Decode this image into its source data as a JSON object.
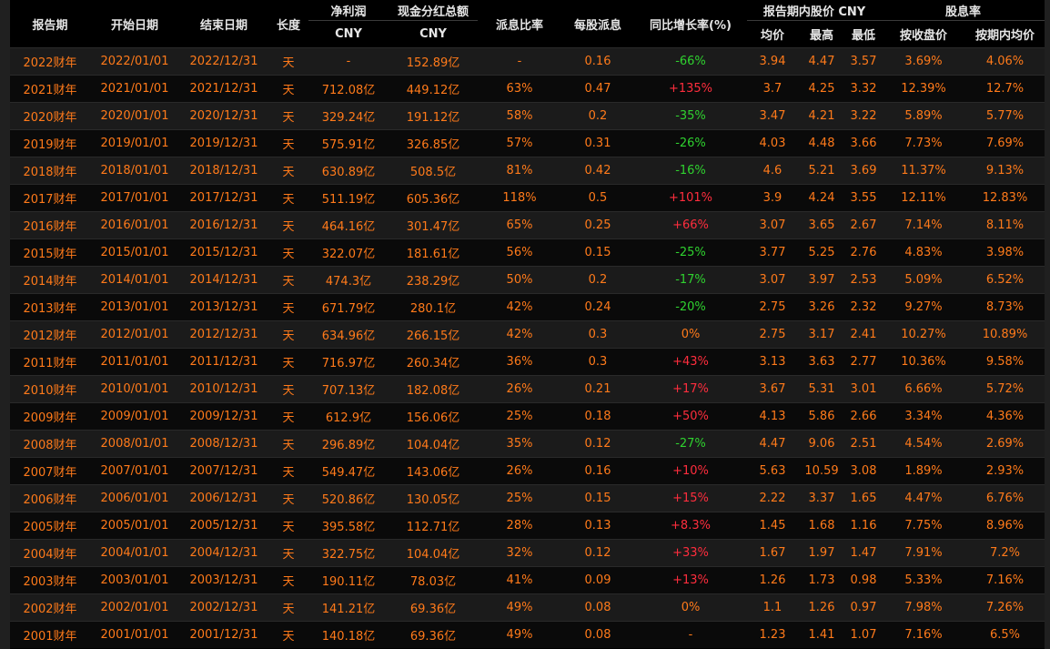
{
  "headers": {
    "period": "报告期",
    "start": "开始日期",
    "end": "结束日期",
    "length": "长度",
    "net_profit": "净利润",
    "net_profit_unit": "CNY",
    "cash_div": "现金分红总额",
    "cash_div_unit": "CNY",
    "payout_ratio": "派息比率",
    "dps": "每股派息",
    "yoy": "同比增长率(%)",
    "price_group": "报告期内股价 CNY",
    "avg": "均价",
    "high": "最高",
    "low": "最低",
    "yield_group": "股息率",
    "yield_close": "按收盘价",
    "yield_avg": "按期内均价"
  },
  "rows": [
    {
      "period": "2022财年",
      "start": "2022/01/01",
      "end": "2022/12/31",
      "len": "天",
      "np": "-",
      "div": "152.89亿",
      "payout": "-",
      "dps": "0.16",
      "yoy": "-66%",
      "yoy_type": "neg",
      "avg": "3.94",
      "high": "4.47",
      "low": "3.57",
      "y_close": "3.69%",
      "y_avg": "4.06%"
    },
    {
      "period": "2021财年",
      "start": "2021/01/01",
      "end": "2021/12/31",
      "len": "天",
      "np": "712.08亿",
      "div": "449.12亿",
      "payout": "63%",
      "dps": "0.47",
      "yoy": "+135%",
      "yoy_type": "pos",
      "avg": "3.7",
      "high": "4.25",
      "low": "3.32",
      "y_close": "12.39%",
      "y_avg": "12.7%"
    },
    {
      "period": "2020财年",
      "start": "2020/01/01",
      "end": "2020/12/31",
      "len": "天",
      "np": "329.24亿",
      "div": "191.12亿",
      "payout": "58%",
      "dps": "0.2",
      "yoy": "-35%",
      "yoy_type": "neg",
      "avg": "3.47",
      "high": "4.21",
      "low": "3.22",
      "y_close": "5.89%",
      "y_avg": "5.77%"
    },
    {
      "period": "2019财年",
      "start": "2019/01/01",
      "end": "2019/12/31",
      "len": "天",
      "np": "575.91亿",
      "div": "326.85亿",
      "payout": "57%",
      "dps": "0.31",
      "yoy": "-26%",
      "yoy_type": "neg",
      "avg": "4.03",
      "high": "4.48",
      "low": "3.66",
      "y_close": "7.73%",
      "y_avg": "7.69%"
    },
    {
      "period": "2018财年",
      "start": "2018/01/01",
      "end": "2018/12/31",
      "len": "天",
      "np": "630.89亿",
      "div": "508.5亿",
      "payout": "81%",
      "dps": "0.42",
      "yoy": "-16%",
      "yoy_type": "neg",
      "avg": "4.6",
      "high": "5.21",
      "low": "3.69",
      "y_close": "11.37%",
      "y_avg": "9.13%"
    },
    {
      "period": "2017财年",
      "start": "2017/01/01",
      "end": "2017/12/31",
      "len": "天",
      "np": "511.19亿",
      "div": "605.36亿",
      "payout": "118%",
      "dps": "0.5",
      "yoy": "+101%",
      "yoy_type": "pos",
      "avg": "3.9",
      "high": "4.24",
      "low": "3.55",
      "y_close": "12.11%",
      "y_avg": "12.83%"
    },
    {
      "period": "2016财年",
      "start": "2016/01/01",
      "end": "2016/12/31",
      "len": "天",
      "np": "464.16亿",
      "div": "301.47亿",
      "payout": "65%",
      "dps": "0.25",
      "yoy": "+66%",
      "yoy_type": "pos",
      "avg": "3.07",
      "high": "3.65",
      "low": "2.67",
      "y_close": "7.14%",
      "y_avg": "8.11%"
    },
    {
      "period": "2015财年",
      "start": "2015/01/01",
      "end": "2015/12/31",
      "len": "天",
      "np": "322.07亿",
      "div": "181.61亿",
      "payout": "56%",
      "dps": "0.15",
      "yoy": "-25%",
      "yoy_type": "neg",
      "avg": "3.77",
      "high": "5.25",
      "low": "2.76",
      "y_close": "4.83%",
      "y_avg": "3.98%"
    },
    {
      "period": "2014财年",
      "start": "2014/01/01",
      "end": "2014/12/31",
      "len": "天",
      "np": "474.3亿",
      "div": "238.29亿",
      "payout": "50%",
      "dps": "0.2",
      "yoy": "-17%",
      "yoy_type": "neg",
      "avg": "3.07",
      "high": "3.97",
      "low": "2.53",
      "y_close": "5.09%",
      "y_avg": "6.52%"
    },
    {
      "period": "2013财年",
      "start": "2013/01/01",
      "end": "2013/12/31",
      "len": "天",
      "np": "671.79亿",
      "div": "280.1亿",
      "payout": "42%",
      "dps": "0.24",
      "yoy": "-20%",
      "yoy_type": "neg",
      "avg": "2.75",
      "high": "3.26",
      "low": "2.32",
      "y_close": "9.27%",
      "y_avg": "8.73%"
    },
    {
      "period": "2012财年",
      "start": "2012/01/01",
      "end": "2012/12/31",
      "len": "天",
      "np": "634.96亿",
      "div": "266.15亿",
      "payout": "42%",
      "dps": "0.3",
      "yoy": "0%",
      "yoy_type": "zero",
      "avg": "2.75",
      "high": "3.17",
      "low": "2.41",
      "y_close": "10.27%",
      "y_avg": "10.89%"
    },
    {
      "period": "2011财年",
      "start": "2011/01/01",
      "end": "2011/12/31",
      "len": "天",
      "np": "716.97亿",
      "div": "260.34亿",
      "payout": "36%",
      "dps": "0.3",
      "yoy": "+43%",
      "yoy_type": "pos",
      "avg": "3.13",
      "high": "3.63",
      "low": "2.77",
      "y_close": "10.36%",
      "y_avg": "9.58%"
    },
    {
      "period": "2010财年",
      "start": "2010/01/01",
      "end": "2010/12/31",
      "len": "天",
      "np": "707.13亿",
      "div": "182.08亿",
      "payout": "26%",
      "dps": "0.21",
      "yoy": "+17%",
      "yoy_type": "pos",
      "avg": "3.67",
      "high": "5.31",
      "low": "3.01",
      "y_close": "6.66%",
      "y_avg": "5.72%"
    },
    {
      "period": "2009财年",
      "start": "2009/01/01",
      "end": "2009/12/31",
      "len": "天",
      "np": "612.9亿",
      "div": "156.06亿",
      "payout": "25%",
      "dps": "0.18",
      "yoy": "+50%",
      "yoy_type": "pos",
      "avg": "4.13",
      "high": "5.86",
      "low": "2.66",
      "y_close": "3.34%",
      "y_avg": "4.36%"
    },
    {
      "period": "2008财年",
      "start": "2008/01/01",
      "end": "2008/12/31",
      "len": "天",
      "np": "296.89亿",
      "div": "104.04亿",
      "payout": "35%",
      "dps": "0.12",
      "yoy": "-27%",
      "yoy_type": "neg",
      "avg": "4.47",
      "high": "9.06",
      "low": "2.51",
      "y_close": "4.54%",
      "y_avg": "2.69%"
    },
    {
      "period": "2007财年",
      "start": "2007/01/01",
      "end": "2007/12/31",
      "len": "天",
      "np": "549.47亿",
      "div": "143.06亿",
      "payout": "26%",
      "dps": "0.16",
      "yoy": "+10%",
      "yoy_type": "pos",
      "avg": "5.63",
      "high": "10.59",
      "low": "3.08",
      "y_close": "1.89%",
      "y_avg": "2.93%"
    },
    {
      "period": "2006财年",
      "start": "2006/01/01",
      "end": "2006/12/31",
      "len": "天",
      "np": "520.86亿",
      "div": "130.05亿",
      "payout": "25%",
      "dps": "0.15",
      "yoy": "+15%",
      "yoy_type": "pos",
      "avg": "2.22",
      "high": "3.37",
      "low": "1.65",
      "y_close": "4.47%",
      "y_avg": "6.76%"
    },
    {
      "period": "2005财年",
      "start": "2005/01/01",
      "end": "2005/12/31",
      "len": "天",
      "np": "395.58亿",
      "div": "112.71亿",
      "payout": "28%",
      "dps": "0.13",
      "yoy": "+8.3%",
      "yoy_type": "pos",
      "avg": "1.45",
      "high": "1.68",
      "low": "1.16",
      "y_close": "7.75%",
      "y_avg": "8.96%"
    },
    {
      "period": "2004财年",
      "start": "2004/01/01",
      "end": "2004/12/31",
      "len": "天",
      "np": "322.75亿",
      "div": "104.04亿",
      "payout": "32%",
      "dps": "0.12",
      "yoy": "+33%",
      "yoy_type": "pos",
      "avg": "1.67",
      "high": "1.97",
      "low": "1.47",
      "y_close": "7.91%",
      "y_avg": "7.2%"
    },
    {
      "period": "2003财年",
      "start": "2003/01/01",
      "end": "2003/12/31",
      "len": "天",
      "np": "190.11亿",
      "div": "78.03亿",
      "payout": "41%",
      "dps": "0.09",
      "yoy": "+13%",
      "yoy_type": "pos",
      "avg": "1.26",
      "high": "1.73",
      "low": "0.98",
      "y_close": "5.33%",
      "y_avg": "7.16%"
    },
    {
      "period": "2002财年",
      "start": "2002/01/01",
      "end": "2002/12/31",
      "len": "天",
      "np": "141.21亿",
      "div": "69.36亿",
      "payout": "49%",
      "dps": "0.08",
      "yoy": "0%",
      "yoy_type": "zero",
      "avg": "1.1",
      "high": "1.26",
      "low": "0.97",
      "y_close": "7.98%",
      "y_avg": "7.26%"
    },
    {
      "period": "2001财年",
      "start": "2001/01/01",
      "end": "2001/12/31",
      "len": "天",
      "np": "140.18亿",
      "div": "69.36亿",
      "payout": "49%",
      "dps": "0.08",
      "yoy": "-",
      "yoy_type": "dash",
      "avg": "1.23",
      "high": "1.41",
      "low": "1.07",
      "y_close": "7.16%",
      "y_avg": "6.5%"
    }
  ]
}
